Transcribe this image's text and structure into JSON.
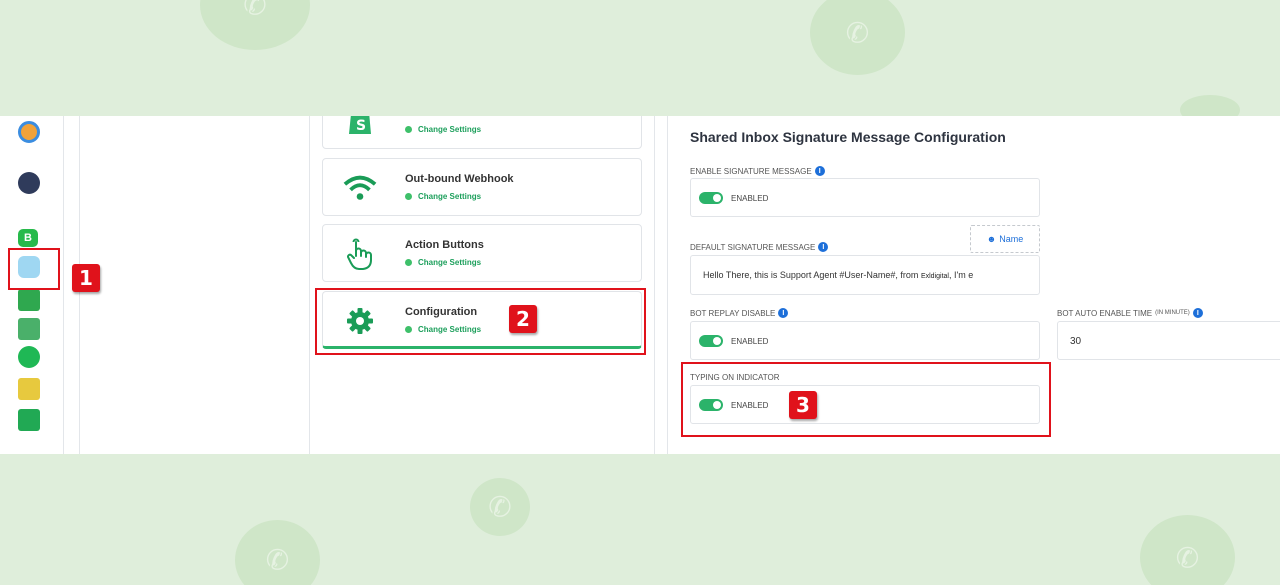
{
  "background": {
    "color": "#dfeedb",
    "blob_color": "#cfe6c8"
  },
  "rail": {
    "icons": [
      "speedometer-icon",
      "chat-bubble-icon",
      "whatsapp-business-icon",
      "chatbot-icon",
      "sheets-icon",
      "megaphone-icon",
      "whatsapp-icon",
      "integration-icon",
      "shopping-bag-icon"
    ]
  },
  "cards": [
    {
      "title": "",
      "status": "Change Settings",
      "icon": "shopify-icon"
    },
    {
      "title": "Out-bound Webhook",
      "status": "Change Settings",
      "icon": "wifi-icon"
    },
    {
      "title": "Action Buttons",
      "status": "Change Settings",
      "icon": "pointer-hand-icon"
    },
    {
      "title": "Configuration",
      "status": "Change Settings",
      "icon": "gear-icon"
    }
  ],
  "content": {
    "heading": "Shared Inbox Signature Message Configuration",
    "enable_signature": {
      "label": "ENABLE SIGNATURE MESSAGE",
      "toggle": "ENABLED"
    },
    "default_signature": {
      "label": "DEFAULT SIGNATURE MESSAGE",
      "name_button": "Name",
      "text": "Hello There, this is Support Agent #User-Name#, from",
      "brand": "Exldigital",
      "suffix": "I'm e"
    },
    "bot_replay": {
      "label": "BOT REPLAY DISABLE",
      "toggle": "ENABLED"
    },
    "bot_auto_enable": {
      "label": "BOT AUTO ENABLE TIME",
      "label_small": "(IN MINUTE)",
      "value": "30"
    },
    "typing_indicator": {
      "label": "TYPING ON INDICATOR",
      "toggle": "ENABLED"
    }
  },
  "annotations": {
    "step1": "1",
    "step2": "2",
    "step3": "3",
    "color": "#e0121b"
  }
}
